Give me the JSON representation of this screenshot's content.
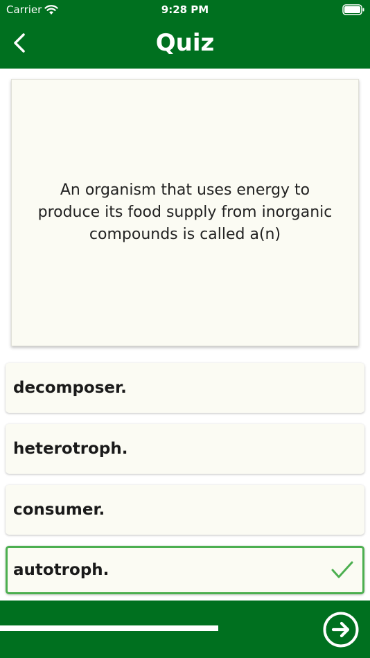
{
  "status_bar": {
    "carrier": "Carrier",
    "time": "9:28 PM",
    "wifi_icon": "wifi-icon",
    "battery_icon": "battery-icon"
  },
  "header": {
    "title": "Quiz",
    "back_icon": "chevron-left-icon"
  },
  "question": {
    "text": "An organism that uses energy to produce its food supply from inorganic compounds is called a(n)"
  },
  "answers": [
    {
      "label": "decomposer."
    },
    {
      "label": "heterotroph."
    },
    {
      "label": "consumer."
    },
    {
      "label": "autotroph.",
      "correct": true
    }
  ],
  "footer": {
    "progress": 0.59,
    "next_icon": "arrow-right-circle-icon"
  },
  "colors": {
    "brand_green": "#00701f",
    "correct_green": "#4caf50",
    "card_background": "#fbfbf3"
  }
}
